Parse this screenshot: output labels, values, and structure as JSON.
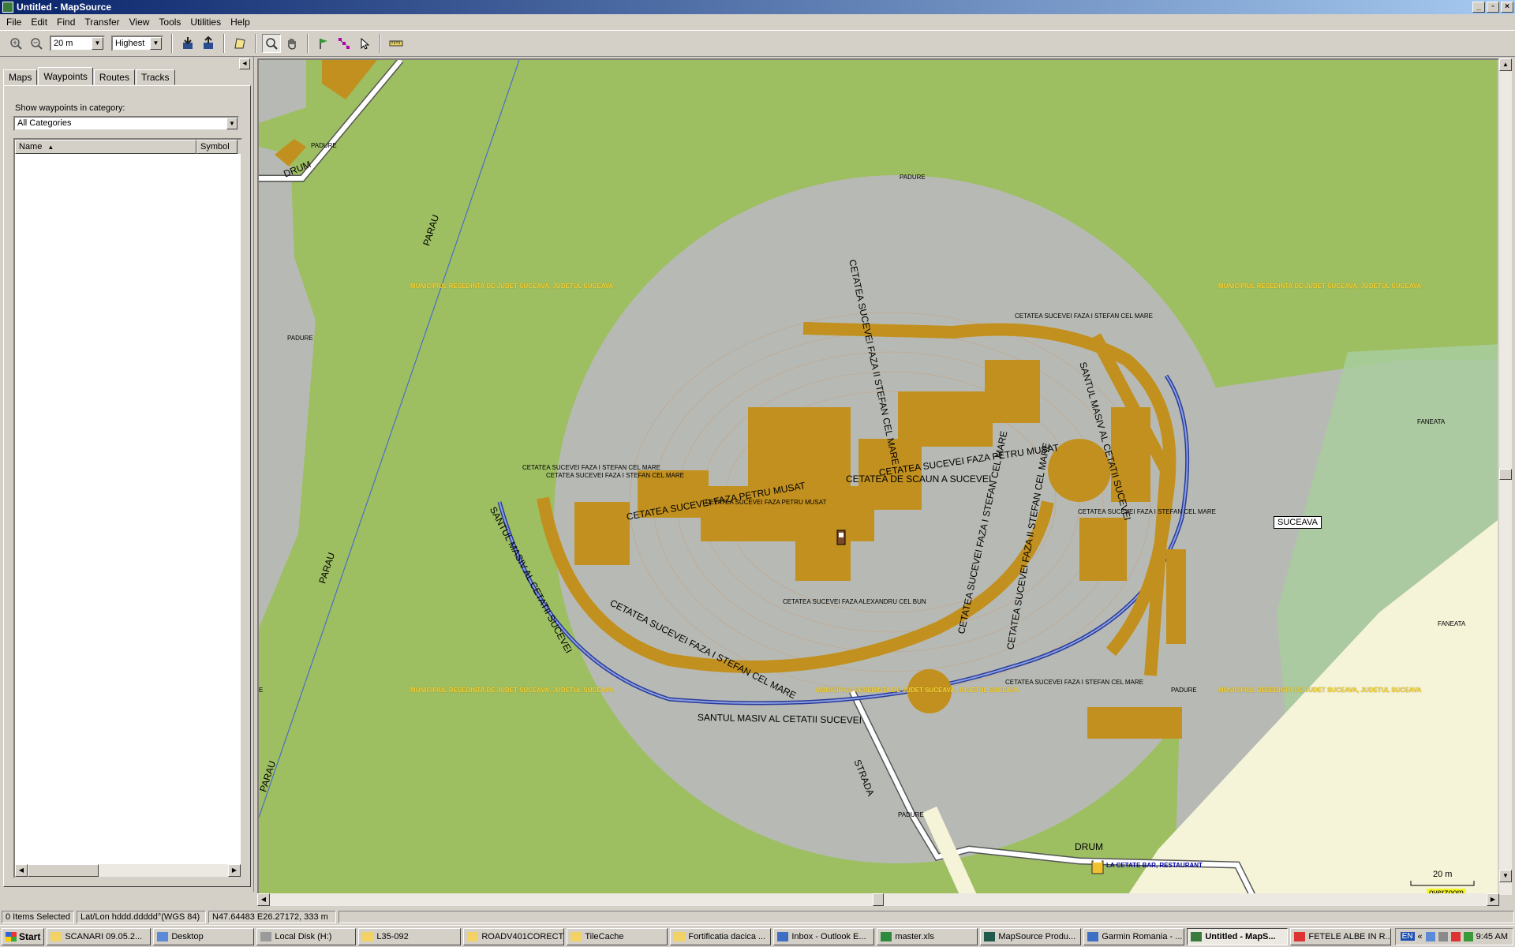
{
  "window": {
    "title": "Untitled - MapSource"
  },
  "menu": [
    "File",
    "Edit",
    "Find",
    "Transfer",
    "View",
    "Tools",
    "Utilities",
    "Help"
  ],
  "toolbar": {
    "zoom_value": "20 m",
    "detail_value": "Highest"
  },
  "panel": {
    "tabs": [
      "Maps",
      "Waypoints",
      "Routes",
      "Tracks"
    ],
    "selected_tab": "Waypoints",
    "category_label": "Show waypoints in category:",
    "category_value": "All Categories",
    "columns": [
      "Name",
      "Symbol"
    ]
  },
  "map": {
    "labels": {
      "drum_top": "DRUM",
      "padure_1": "PADURE",
      "padure_2": "PADURE",
      "padure_3": "PADURE",
      "padure_4": "PADURE",
      "padure_5": "PADURE",
      "parau_1": "PARAU",
      "parau_2": "PARAU",
      "parau_3": "PARAU",
      "municipiu_1": "MUNICIPIUL RESEDINTA DE JUDET SUCEAVA, JUDETUL SUCEAVA",
      "municipiu_2": "MUNICIPIUL RESEDINTA DE JUDET SUCEAVA, JUDETUL SUCEAVA",
      "municipiu_3": "MUNICIPIUL RESEDINTA DE JUDET SUCEAVA, JUDETUL SUCEAVA",
      "municipiu_4": "MUNICIPIUL RESEDINTA DE JUDET SUCEAVA, JUDETUL SUCEAVA",
      "municipiu_5": "MUNICIPIUL RESEDINTA DE JUDET SUCEAVA, JUDETUL SUCEAVA",
      "faza_stefan_1": "CETATEA SUCEVEI FAZA I STEFAN CEL MARE",
      "faza_stefan_2": "CETATEA SUCEVEI FAZA I STEFAN CEL MARE",
      "faza_stefan_3": "CETATEA SUCEVEI FAZA I STEFAN CEL MARE",
      "faza_stefan_4": "CETATEA SUCEVEI FAZA I STEFAN CEL MARE",
      "faza_stefan_5": "CETATEA SUCEVEI FAZA I STEFAN CEL MARE",
      "faza_petru_small": "CETATEA SUCEVEI FAZA PETRU MUSAT",
      "faza_alexandru": "CETATEA SUCEVEI FAZA ALEXANDRU CEL BUN",
      "faza_petru_big_1": "CETATEA SUCEVEI FAZA PETRU MUSAT",
      "faza_petru_big_2": "CETATEA SUCEVEI FAZA PETRU MUSAT",
      "faza_ii_stefan_big_1": "CETATEA SUCEVEI FAZA II STEFAN CEL MARE",
      "faza_ii_stefan_big_2": "CETATEA SUCEVEI FAZA II STEFAN CEL MARE",
      "faza_i_stefan_big_1": "CETATEA SUCEVEI FAZA I STEFAN CEL MARE",
      "faza_i_stefan_big_2": "CETATEA SUCEVEI FAZA I STEFAN CEL MARE",
      "santul_1": "SANTUL MASIV AL CETATII SUCEVEI",
      "santul_2": "SANTUL MASIV AL CETATII SUCEVEI",
      "santul_3": "SANTUL MASIV AL CETATII SUCEVEI",
      "poi": "CETATEA DE SCAUN A SUCEVEI",
      "strada": "STRADA",
      "drum_bottom": "DRUM",
      "faneata_1": "FANEATA",
      "faneata_2": "FANEATA",
      "city": "SUCEAVA",
      "restaurant": "LA CETATE BAR, RESTAURANT",
      "edge_e": "E"
    },
    "scale": "20 m",
    "overzoom": "overzoom"
  },
  "status": {
    "selection": "0 Items Selected",
    "format": "Lat/Lon hddd.ddddd°(WGS 84)",
    "position": "N47.64483 E26.27172, 333 m"
  },
  "taskbar": {
    "start": "Start",
    "tasks": [
      "SCANARI 09.05.2...",
      "Desktop",
      "Local Disk (H:)",
      "L35-092",
      "ROADV401CORECT",
      "TileCache",
      "Fortificatia dacica ...",
      "Inbox - Outlook E...",
      "master.xls",
      "MapSource Produ...",
      "Garmin Romania - ...",
      "Untitled - MapS...",
      "FETELE ALBE IN R..."
    ],
    "active_index": 11,
    "lang": "EN",
    "clock": "9:45 AM"
  }
}
